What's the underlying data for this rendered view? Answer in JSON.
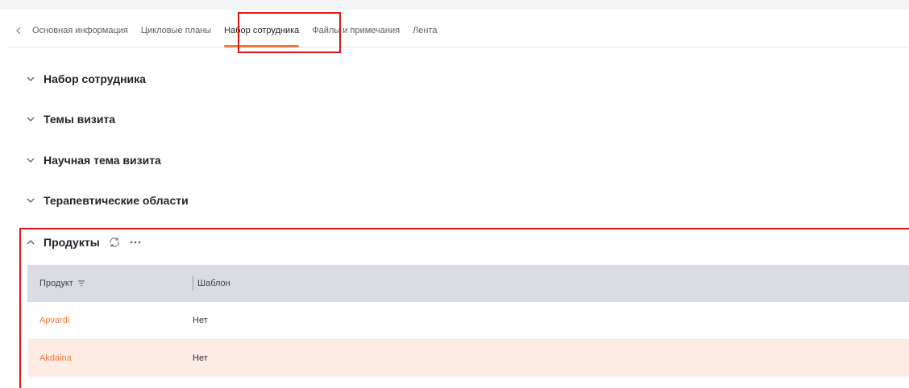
{
  "tabs": [
    {
      "label": "Основная информация"
    },
    {
      "label": "Цикловые планы"
    },
    {
      "label": "Набор сотрудника",
      "active": true
    },
    {
      "label": "Файлы и примечания"
    },
    {
      "label": "Лента"
    }
  ],
  "sections": {
    "s1": "Набор сотрудника",
    "s2": "Темы визита",
    "s3": "Научная тема визита",
    "s4": "Терапевтические области",
    "s5": "Продукты"
  },
  "table": {
    "col_product": "Продукт",
    "col_template": "Шаблон",
    "rows": [
      {
        "product": "Apvardi",
        "template": "Нет"
      },
      {
        "product": "Akdaina",
        "template": "Нет"
      }
    ]
  },
  "colors": {
    "accent": "#f07a3e",
    "highlight": "#e01616",
    "header_bg": "#d9dce2",
    "selected_row": "#fdece4"
  },
  "icons": [
    "chevron-left-icon",
    "chevron-down-icon",
    "chevron-up-icon",
    "refresh-icon",
    "more-icon",
    "sort-icon"
  ]
}
